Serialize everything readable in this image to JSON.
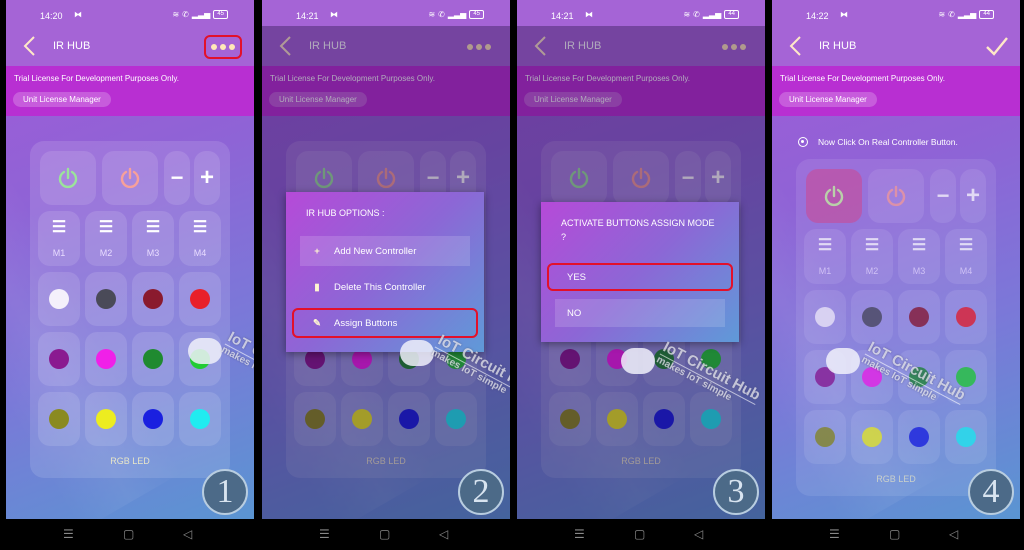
{
  "app": {
    "title": "IR HUB",
    "license_message": "Trial License For Development Purposes Only.",
    "license_button": "Unit License Manager",
    "remote_label": "RGB LED",
    "mode_labels": [
      "M1",
      "M2",
      "M3",
      "M4"
    ],
    "volume_minus": "−",
    "volume_plus": "+",
    "power_on_icon": "power-green-icon",
    "power_off_icon": "power-red-icon",
    "color_buttons": [
      {
        "name": "white",
        "color": "#f4f0fb"
      },
      {
        "name": "dark-gray",
        "color": "#4a4a58"
      },
      {
        "name": "maroon",
        "color": "#8a1a2e"
      },
      {
        "name": "red",
        "color": "#e8202a"
      },
      {
        "name": "purple",
        "color": "#8a1a90"
      },
      {
        "name": "magenta",
        "color": "#f020e8"
      },
      {
        "name": "green",
        "color": "#1f8a30"
      },
      {
        "name": "bright-green",
        "color": "#22cc33"
      },
      {
        "name": "olive",
        "color": "#8a8a20"
      },
      {
        "name": "yellow",
        "color": "#ecec20"
      },
      {
        "name": "blue",
        "color": "#1a20e0"
      },
      {
        "name": "cyan",
        "color": "#20ecf0"
      }
    ]
  },
  "watermark": {
    "title": "IoT Circuit Hub",
    "subtitle": "makes IoT simple"
  },
  "steps": [
    {
      "number": "1",
      "time": "14:20",
      "battery": "45",
      "action_icon": "more-options-icon",
      "highlight": "more-options-button"
    },
    {
      "number": "2",
      "time": "14:21",
      "battery": "45",
      "action_icon": "more-options-icon",
      "menu": {
        "title": "IR HUB OPTIONS :",
        "items": [
          {
            "label": "Add New Controller",
            "icon": "plus-icon",
            "glyph": "+"
          },
          {
            "label": "Delete This Controller",
            "icon": "trash-icon",
            "glyph": "🗑"
          },
          {
            "label": "Assign Buttons",
            "icon": "edit-icon",
            "glyph": "✎",
            "highlighted": true
          }
        ]
      }
    },
    {
      "number": "3",
      "time": "14:21",
      "battery": "44",
      "action_icon": "more-options-icon",
      "dialog": {
        "question": "ACTIVATE BUTTONS ASSIGN MODE ?",
        "yes": "YES",
        "no": "NO"
      }
    },
    {
      "number": "4",
      "time": "14:22",
      "battery": "44",
      "action_icon": "checkmark-icon",
      "hint": "Now Click On Real Controller Button.",
      "active_key": "power-on"
    }
  ],
  "navbar": {
    "menu": "☰",
    "home": "▢",
    "back": "◁"
  }
}
